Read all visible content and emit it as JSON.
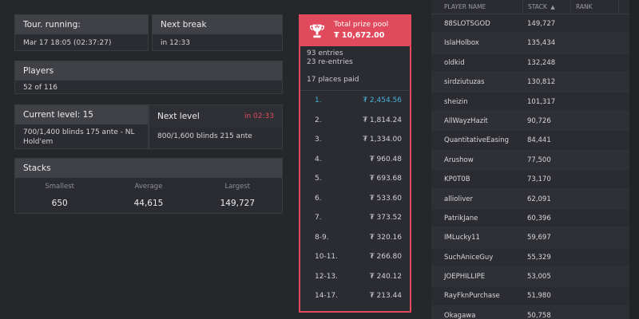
{
  "tour": {
    "label": "Tour. running:",
    "value": "Mar 17 18:05 (02:37:27)"
  },
  "next_break": {
    "label": "Next break",
    "value": "in 12:33"
  },
  "players": {
    "label": "Players",
    "value": "52 of 116"
  },
  "current_level": {
    "label": "Current level: 15",
    "value": "700/1,400 blinds 175 ante - NL Hold'em"
  },
  "next_level": {
    "label": "Next level",
    "countdown": "in 02:33",
    "value": "800/1,600 blinds 215 ante"
  },
  "stacks": {
    "label": "Stacks",
    "headers": [
      "Smallest",
      "Average",
      "Largest"
    ],
    "values": [
      "650",
      "44,615",
      "149,727"
    ]
  },
  "prize": {
    "title": "Total prize pool",
    "amount": "₮ 10,672.00",
    "entries": "93 entries",
    "reentries": "23 re-entries",
    "places_paid": "17 places paid",
    "rows": [
      {
        "place": "1.",
        "amount": "₮ 2,454.56"
      },
      {
        "place": "2.",
        "amount": "₮ 1,814.24"
      },
      {
        "place": "3.",
        "amount": "₮ 1,334.00"
      },
      {
        "place": "4.",
        "amount": "₮ 960.48"
      },
      {
        "place": "5.",
        "amount": "₮ 693.68"
      },
      {
        "place": "6.",
        "amount": "₮ 533.60"
      },
      {
        "place": "7.",
        "amount": "₮ 373.52"
      },
      {
        "place": "8-9.",
        "amount": "₮ 320.16"
      },
      {
        "place": "10-11.",
        "amount": "₮ 266.80"
      },
      {
        "place": "12-13.",
        "amount": "₮ 240.12"
      },
      {
        "place": "14-17.",
        "amount": "₮ 213.44"
      }
    ],
    "accent": "#e04a5c",
    "highlight": "#4ab0d8"
  },
  "player_table": {
    "headers": {
      "name": "PLAYER NAME",
      "stack": "STACK",
      "rank": "RANK"
    },
    "sort_icon": "sort-up-icon",
    "rows": [
      {
        "name": "88SLOTSGOD",
        "stack": "149,727"
      },
      {
        "name": "IslaHolbox",
        "stack": "135,434"
      },
      {
        "name": "oldkid",
        "stack": "132,248"
      },
      {
        "name": "sirdziutuzas",
        "stack": "130,812"
      },
      {
        "name": "sheizin",
        "stack": "101,317"
      },
      {
        "name": "AllWayzHazit",
        "stack": "90,726"
      },
      {
        "name": "QuantitativeEasing",
        "stack": "84,441"
      },
      {
        "name": "Arushow",
        "stack": "77,500"
      },
      {
        "name": "KP0T0B",
        "stack": "73,170"
      },
      {
        "name": "allioliver",
        "stack": "62,091"
      },
      {
        "name": "PatrikJane",
        "stack": "60,396"
      },
      {
        "name": "IMLucky11",
        "stack": "59,697"
      },
      {
        "name": "SuchAniceGuy",
        "stack": "55,329"
      },
      {
        "name": "JOEPHILLIPE",
        "stack": "53,005"
      },
      {
        "name": "RayFknPurchase",
        "stack": "51,980"
      },
      {
        "name": "Okagawa",
        "stack": "50,758"
      }
    ]
  },
  "trophy_icon": "trophy-icon"
}
